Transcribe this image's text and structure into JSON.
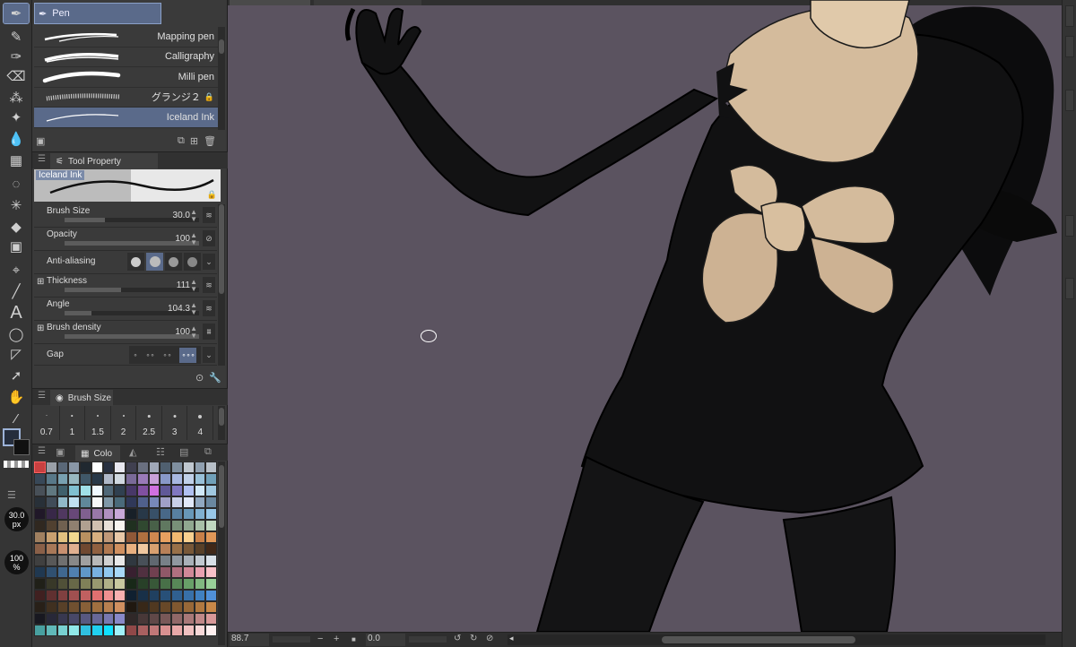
{
  "subtool": {
    "header": "Pen",
    "brushes": [
      {
        "name": "Mapping pen",
        "selected": false
      },
      {
        "name": "Calligraphy",
        "selected": false
      },
      {
        "name": "Milli pen",
        "selected": false
      },
      {
        "name": "グランジ２",
        "selected": false,
        "locked": true
      },
      {
        "name": "Iceland Ink",
        "selected": true
      }
    ]
  },
  "tool_property": {
    "tab_label": "Tool Property",
    "preview_label": "Iceland Ink",
    "brush_size": {
      "label": "Brush Size",
      "value": "30.0",
      "fraction": 0.3
    },
    "opacity": {
      "label": "Opacity",
      "value": "100",
      "fraction": 1.0
    },
    "anti_aliasing": {
      "label": "Anti-aliasing",
      "selected_index": 1
    },
    "thickness": {
      "label": "Thickness",
      "value": "111",
      "fraction": 0.42
    },
    "angle": {
      "label": "Angle",
      "value": "104.3",
      "fraction": 0.2
    },
    "brush_density": {
      "label": "Brush density",
      "value": "100",
      "fraction": 1.0
    },
    "gap": {
      "label": "Gap"
    }
  },
  "brush_size_panel": {
    "tab_label": "Brush Size",
    "sizes": [
      "0.7",
      "1",
      "1.5",
      "2",
      "2.5",
      "3",
      "4"
    ]
  },
  "color_panel": {
    "tab_label": "Colo"
  },
  "toolbar_readouts": {
    "size_value": "30.0",
    "size_unit": "px",
    "opacity_value": "100",
    "opacity_unit": "%"
  },
  "statusbar": {
    "zoom": "88.7",
    "angle": "0.0"
  },
  "colors": {
    "canvas_bg": "#5b5360",
    "accent": "#5a6a8a",
    "main_color": "#252d3c",
    "sub_color": "#111111"
  },
  "palette_colors": [
    "#c84040",
    "#9aa0a8",
    "#5a6878",
    "#8a98a8",
    "#202830",
    "#ffffff",
    "#283040",
    "#e8e8f0",
    "#404050",
    "#6a7080",
    "#a0a8b8",
    "#506070",
    "#8090a0",
    "#c0c8d0",
    "#90a0b0",
    "#b8c0c8",
    "#384858",
    "#587888",
    "#78a0b0",
    "#98b8c0",
    "#405868",
    "#283848",
    "#b0b8c8",
    "#d0d8e0",
    "#7a6a98",
    "#9a7ab8",
    "#c8a0d8",
    "#8898c8",
    "#a8b8e0",
    "#c0d0e8",
    "#98c0d8",
    "#70a0b8",
    "#485058",
    "#607880",
    "#40606c",
    "#80c0d0",
    "#a0e0e8",
    "#f0f8ff",
    "#506878",
    "#304050",
    "#483868",
    "#8050a0",
    "#d070e0",
    "#605898",
    "#8078c0",
    "#b0c0f0",
    "#d0e8f8",
    "#a0c8e0",
    "#283038",
    "#404c58",
    "#90b8c8",
    "#c0e0f0",
    "#60889a",
    "#f8f8f8",
    "#8098a8",
    "#4a6a7a",
    "#303858",
    "#50608c",
    "#7888b8",
    "#a0a0c8",
    "#c8d0e8",
    "#e0e8f8",
    "#90a8c0",
    "#6a88a0",
    "#201828",
    "#382848",
    "#503860",
    "#684878",
    "#806090",
    "#9878a8",
    "#b090c0",
    "#c8a8d8",
    "#182028",
    "#283848",
    "#385068",
    "#486888",
    "#5880a0",
    "#6898b8",
    "#80b0d0",
    "#98c8e8",
    "#302820",
    "#504030",
    "#706050",
    "#908070",
    "#b0a090",
    "#d0c0b0",
    "#e8e0d8",
    "#f8f4f0",
    "#203020",
    "#304830",
    "#486048",
    "#607860",
    "#789078",
    "#90a890",
    "#a8c0a8",
    "#c0d8c0",
    "#a08060",
    "#c8a070",
    "#e0c080",
    "#f0d890",
    "#b89060",
    "#d8b080",
    "#c09878",
    "#e8c8a8",
    "#905838",
    "#b07040",
    "#d08850",
    "#e8a060",
    "#f0b870",
    "#f8d090",
    "#c88048",
    "#e09858",
    "#8a6048",
    "#a87858",
    "#c89070",
    "#e0b090",
    "#704830",
    "#906040",
    "#b07850",
    "#d09060",
    "#e8b080",
    "#f0c8a0",
    "#d8a070",
    "#b88058",
    "#987048",
    "#785838",
    "#584028",
    "#402818",
    "#404040",
    "#585858",
    "#707070",
    "#888888",
    "#a0a0a0",
    "#b8b8b8",
    "#d0d0d0",
    "#e8e8e8",
    "#303840",
    "#485058",
    "#606870",
    "#788088",
    "#9098a0",
    "#a8b0b8",
    "#c0c8d0",
    "#d8e0e8",
    "#203850",
    "#305070",
    "#406890",
    "#5080b0",
    "#6098c8",
    "#78b0e0",
    "#90c8f0",
    "#a8d8f8",
    "#382030",
    "#503040",
    "#704050",
    "#905868",
    "#b07080",
    "#d08898",
    "#e8a0b0",
    "#f8c0c8",
    "#202018",
    "#383828",
    "#505038",
    "#686848",
    "#808058",
    "#989870",
    "#b0b088",
    "#c8c8a0",
    "#182818",
    "#284028",
    "#385838",
    "#487048",
    "#588858",
    "#68a068",
    "#80b880",
    "#98d098",
    "#402020",
    "#603030",
    "#804040",
    "#a05050",
    "#c06060",
    "#e07070",
    "#f09090",
    "#f8b0b0",
    "#102030",
    "#183048",
    "#204060",
    "#285078",
    "#306090",
    "#3870a8",
    "#4080c0",
    "#5090d8",
    "#282018",
    "#403020",
    "#584028",
    "#705030",
    "#886038",
    "#a07040",
    "#b88050",
    "#d09060",
    "#201810",
    "#382818",
    "#503820",
    "#684828",
    "#805830",
    "#986838",
    "#b07840",
    "#c88848",
    "#181820",
    "#282838",
    "#383850",
    "#484868",
    "#585880",
    "#686898",
    "#7878b0",
    "#8888c8",
    "#302828",
    "#483838",
    "#604848",
    "#785858",
    "#906868",
    "#a87878",
    "#c08888",
    "#d89898",
    "#48a0a0",
    "#60b8b8",
    "#78d0d0",
    "#90e8e8",
    "#30c0e0",
    "#20d0f0",
    "#10e0ff",
    "#a0f0f8",
    "#904848",
    "#a86060",
    "#c07878",
    "#d89090",
    "#e8a8a8",
    "#f0c0c0",
    "#f8d8d8",
    "#fff0f0"
  ]
}
